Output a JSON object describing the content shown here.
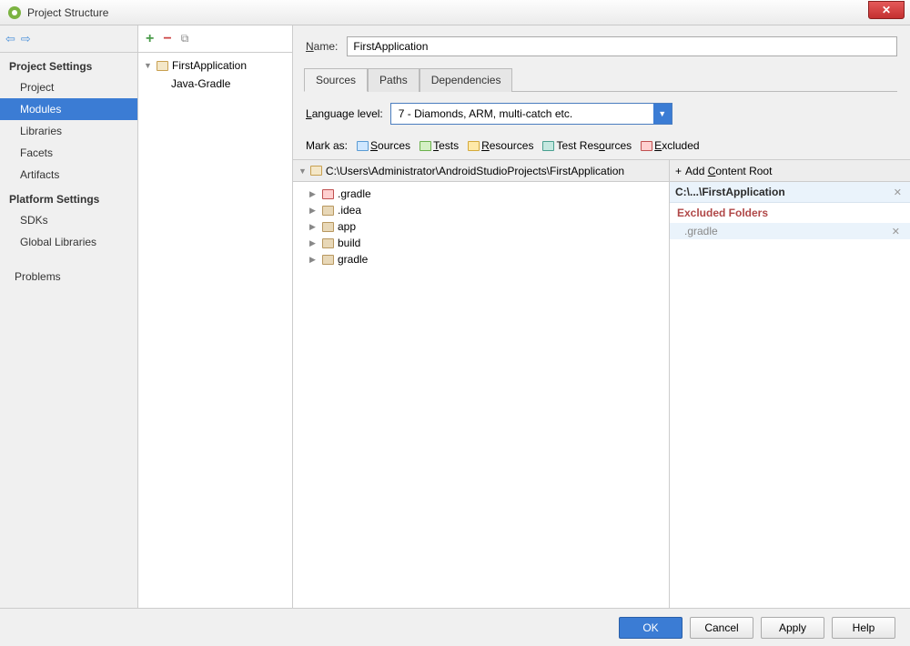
{
  "window": {
    "title": "Project Structure"
  },
  "sidebar": {
    "sections": [
      {
        "header": "Project Settings",
        "items": [
          "Project",
          "Modules",
          "Libraries",
          "Facets",
          "Artifacts"
        ],
        "selected": 1
      },
      {
        "header": "Platform Settings",
        "items": [
          "SDKs",
          "Global Libraries"
        ]
      }
    ],
    "problems": "Problems"
  },
  "modules": {
    "root": "FirstApplication",
    "children": [
      "Java-Gradle"
    ]
  },
  "detail": {
    "name_label": "Name:",
    "name_value": "FirstApplication",
    "tabs": [
      "Sources",
      "Paths",
      "Dependencies"
    ],
    "active_tab": 0,
    "language_label": "Language level:",
    "language_value": "7 - Diamonds, ARM, multi-catch etc.",
    "mark_label": "Mark as:",
    "marks": [
      {
        "label": "Sources",
        "cls": "blue",
        "u": "S"
      },
      {
        "label": "Tests",
        "cls": "green",
        "u": "T"
      },
      {
        "label": "Resources",
        "cls": "yellow",
        "u": "R"
      },
      {
        "label": "Test Resources",
        "cls": "teal",
        "u": ""
      },
      {
        "label": "Excluded",
        "cls": "red",
        "u": "E"
      }
    ],
    "root_path": "C:\\Users\\Administrator\\AndroidStudioProjects\\FirstApplication",
    "folders": [
      {
        "name": ".gradle",
        "cls": "red"
      },
      {
        "name": ".idea",
        "cls": "brown"
      },
      {
        "name": "app",
        "cls": "brown"
      },
      {
        "name": "build",
        "cls": "brown"
      },
      {
        "name": "gradle",
        "cls": "brown"
      }
    ],
    "right": {
      "add_root": "Add Content Root",
      "path_short": "C:\\...\\FirstApplication",
      "excluded_label": "Excluded Folders",
      "excluded_items": [
        ".gradle"
      ]
    }
  },
  "buttons": {
    "ok": "OK",
    "cancel": "Cancel",
    "apply": "Apply",
    "help": "Help"
  }
}
